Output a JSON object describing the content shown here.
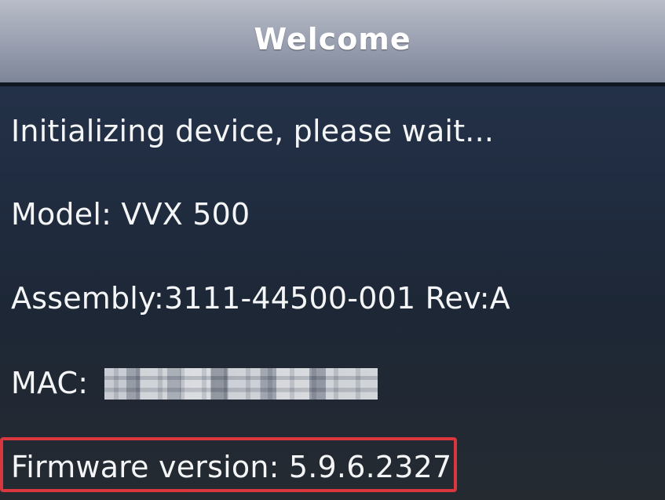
{
  "window": {
    "title": "Welcome"
  },
  "status": {
    "initializing_text": "Initializing device, please wait..."
  },
  "device_info": {
    "model_text": "Model: VVX 500",
    "assembly_text": "Assembly:3111-44500-001 Rev:A",
    "mac_label": "MAC:",
    "mac_value": "",
    "firmware_text": "Firmware version: 5.9.6.2327"
  },
  "colors": {
    "title_bar_start": "#b9bdc8",
    "title_bar_end": "#7d8598",
    "background_top": "#26354f",
    "background_bottom": "#252a31",
    "text": "#f4f5f7",
    "highlight": "#d9363e"
  }
}
